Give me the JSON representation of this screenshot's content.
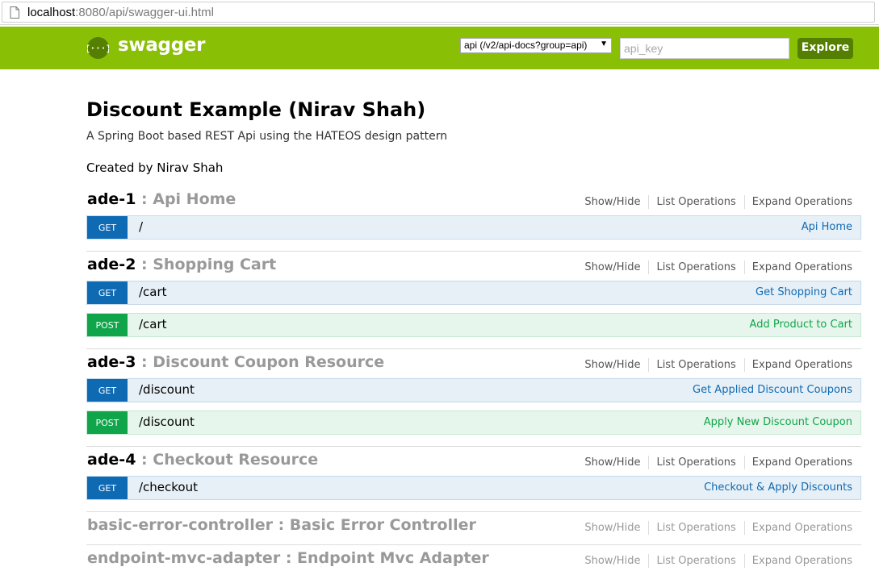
{
  "browser": {
    "url_host": "localhost",
    "url_rest": ":8080/api/swagger-ui.html"
  },
  "header": {
    "logo_text": "swagger",
    "api_select": "api (/v2/api-docs?group=api)",
    "api_key_placeholder": "api_key",
    "explore_label": "Explore",
    "brand_color": "#89bf04"
  },
  "info": {
    "title": "Discount Example (Nirav Shah)",
    "description": "A Spring Boot based REST Api using the HATEOS design pattern",
    "created_by": "Created by Nirav Shah"
  },
  "ops_labels": {
    "show_hide": "Show/Hide",
    "list_operations": "List Operations",
    "expand_operations": "Expand Operations"
  },
  "resources": [
    {
      "id": "ade-1",
      "sep": " : ",
      "label": "Api Home",
      "operations": [
        {
          "method": "GET",
          "path": "/",
          "summary": "Api Home"
        }
      ]
    },
    {
      "id": "ade-2",
      "sep": " : ",
      "label": "Shopping Cart",
      "operations": [
        {
          "method": "GET",
          "path": "/cart",
          "summary": "Get Shopping Cart"
        },
        {
          "method": "POST",
          "path": "/cart",
          "summary": "Add Product to Cart"
        }
      ]
    },
    {
      "id": "ade-3",
      "sep": " : ",
      "label": "Discount Coupon Resource",
      "operations": [
        {
          "method": "GET",
          "path": "/discount",
          "summary": "Get Applied Discount Coupons"
        },
        {
          "method": "POST",
          "path": "/discount",
          "summary": "Apply New Discount Coupon"
        }
      ]
    },
    {
      "id": "ade-4",
      "sep": " : ",
      "label": "Checkout Resource",
      "operations": [
        {
          "method": "GET",
          "path": "/checkout",
          "summary": "Checkout & Apply Discounts"
        }
      ]
    },
    {
      "id": "basic-error-controller",
      "sep": " : ",
      "label": "Basic Error Controller",
      "operations": []
    },
    {
      "id": "endpoint-mvc-adapter",
      "sep": " : ",
      "label": "Endpoint Mvc Adapter",
      "operations": []
    }
  ]
}
